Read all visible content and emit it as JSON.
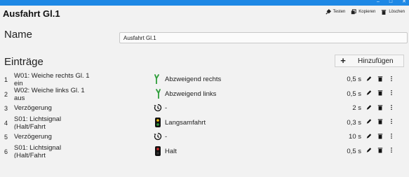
{
  "window": {
    "controls": [
      "–",
      "□",
      "✕"
    ]
  },
  "header": {
    "title": "Ausfahrt Gl.1",
    "toolbar": {
      "test_label": "Testen",
      "copy_label": "Kopieren",
      "delete_label": "Löschen"
    }
  },
  "name_field": {
    "label": "Name",
    "value": "Ausfahrt Gl.1"
  },
  "entries": {
    "heading": "Einträge",
    "add_label": "Hinzufügen",
    "add_icon": "+",
    "rows": [
      {
        "index": "1",
        "name": "W01: Weiche rechts Gl. 1 ein",
        "icon": "switch-icon",
        "state": "Abzweigend rechts",
        "duration": "0,5 s"
      },
      {
        "index": "2",
        "name": "W02: Weiche links Gl. 1 aus",
        "icon": "switch-icon",
        "state": "Abzweigend links",
        "duration": "0,5 s"
      },
      {
        "index": "3",
        "name": "Verzögerung",
        "icon": "timer-icon",
        "state": "-",
        "duration": "2 s"
      },
      {
        "index": "4",
        "name": "S01: Lichtsignal (Halt/Fahrt",
        "icon": "signal-caution-icon",
        "state": "Langsamfahrt",
        "duration": "0,3 s"
      },
      {
        "index": "5",
        "name": "Verzögerung",
        "icon": "timer-icon",
        "state": "-",
        "duration": "10 s"
      },
      {
        "index": "6",
        "name": "S01: Lichtsignal (Halt/Fahrt",
        "icon": "signal-stop-icon",
        "state": "Halt",
        "duration": "0,5 s"
      }
    ]
  },
  "colors": {
    "titlebar": "#1e88e5",
    "switch_green": "#2e9e3a",
    "signal_red": "#d32f2f",
    "signal_yellow": "#f4c20d"
  }
}
